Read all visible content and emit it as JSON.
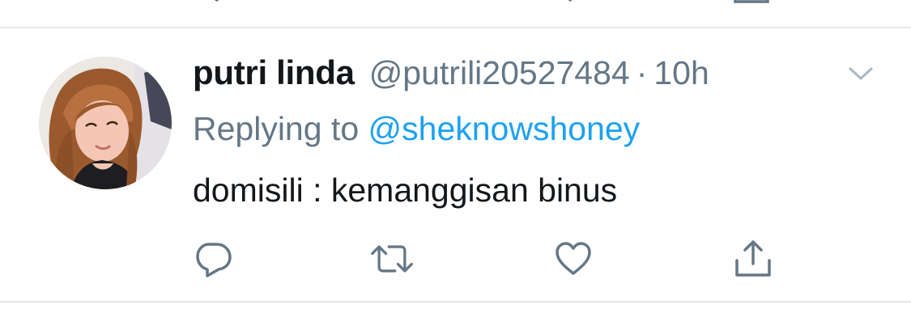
{
  "tweet": {
    "display_name": "putri linda",
    "handle": "@putrili20527484",
    "separator": "·",
    "timestamp": "10h",
    "replying_to_label": "Replying to",
    "replying_to_handle": "@sheknowshoney",
    "text": "domisili : kemanggisan binus"
  },
  "icons": {
    "avatar": "profile-photo",
    "caret": "chevron-down-icon",
    "reply": "reply-icon",
    "retweet": "retweet-icon",
    "like": "heart-icon",
    "share": "share-icon"
  },
  "colors": {
    "primary_text": "#14171a",
    "secondary_text": "#657786",
    "link": "#1da1f2",
    "divider": "#e1e8ed"
  }
}
